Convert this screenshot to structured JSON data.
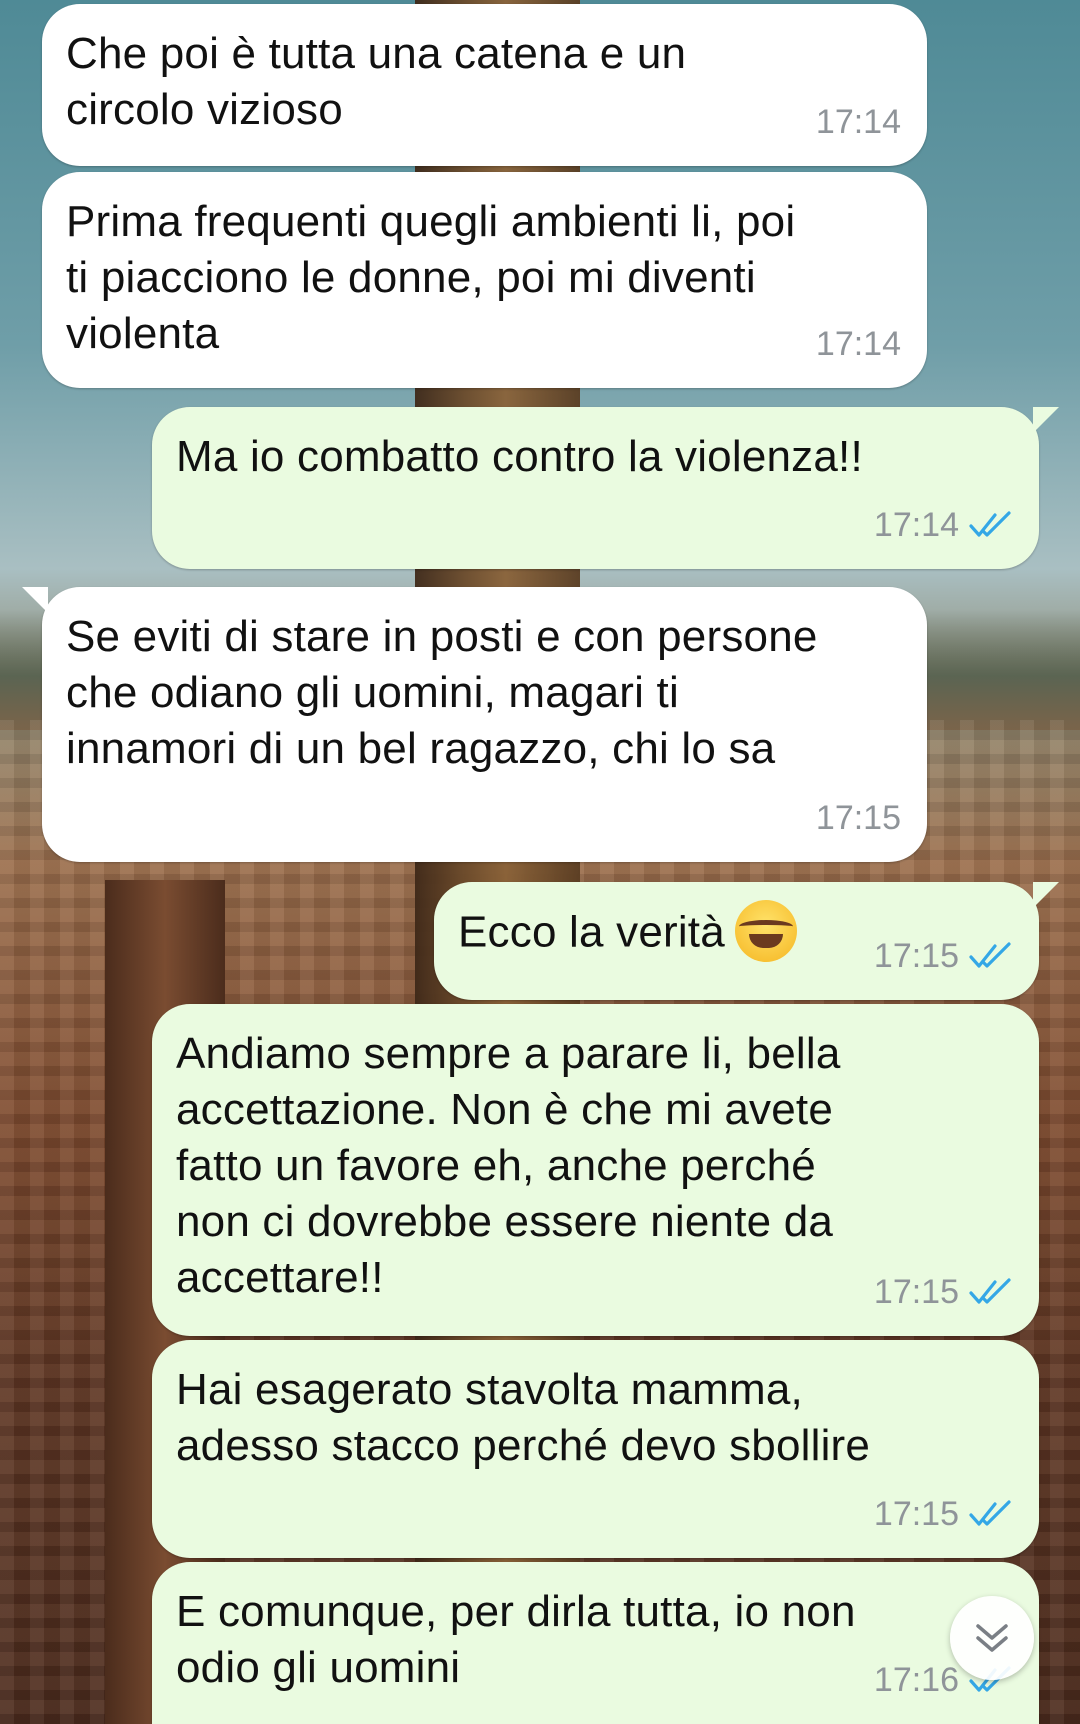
{
  "messages": [
    {
      "direction": "incoming",
      "text": "Che poi è tutta una catena e un\ncircolo vizioso",
      "time": "17:14"
    },
    {
      "direction": "incoming",
      "text": "Prima frequenti quegli ambienti li, poi\nti piacciono le donne, poi mi diventi\nviolenta",
      "time": "17:14"
    },
    {
      "direction": "outgoing",
      "text": "Ma io combatto contro la violenza!!",
      "time": "17:14",
      "status": "read"
    },
    {
      "direction": "incoming",
      "text": "Se eviti di stare in posti e con persone\nche odiano gli uomini, magari ti\ninnamori di un bel ragazzo, chi lo sa",
      "time": "17:15"
    },
    {
      "direction": "outgoing",
      "text": "Ecco la verità",
      "emoji": "face-with-tears-of-joy",
      "time": "17:15",
      "status": "read"
    },
    {
      "direction": "outgoing",
      "text": "Andiamo sempre a parare li, bella\naccettazione. Non è che mi avete\nfatto un favore eh, anche perché\nnon ci dovrebbe essere niente da\naccettare!!",
      "time": "17:15",
      "status": "read"
    },
    {
      "direction": "outgoing",
      "text": "Hai esagerato stavolta mamma,\nadesso stacco perché devo sbollire",
      "time": "17:15",
      "status": "read"
    },
    {
      "direction": "outgoing",
      "text": "E comunque, per dirla tutta, io non\nodio gli uomini",
      "time": "17:16",
      "status": "read"
    }
  ],
  "colors": {
    "incoming_bubble": "#ffffff",
    "outgoing_bubble": "#eafbe0",
    "tick_blue": "#34a7e6",
    "time_gray": "#8f9499"
  },
  "icons": {
    "read_receipt": "double-check-icon",
    "scroll": "chevron-double-down-icon"
  }
}
